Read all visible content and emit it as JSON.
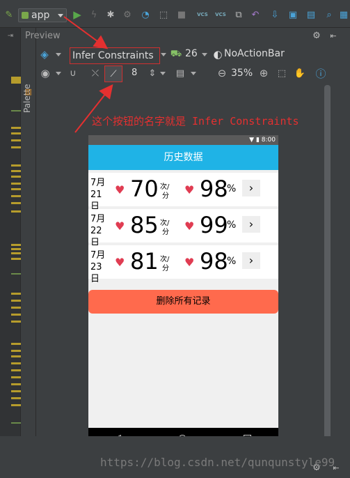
{
  "toolbar": {
    "app_config": "app",
    "vcs_1": "VCS",
    "vcs_2": "VCS"
  },
  "sidebar": {
    "palette_label": "Palette",
    "preview_label": "Preview"
  },
  "design_toolbar": {
    "infer_constraints_label": "Infer Constraints",
    "api_level": "26",
    "theme": "NoActionBar",
    "margin_value": "8",
    "zoom": "35%"
  },
  "annotation": {
    "text": "这个按钮的名字就是 Infer Constraints",
    "watermark": "https://blog.csdn.net/qunqunstyle99"
  },
  "phone": {
    "status_time": "8:00",
    "title": "历史数据",
    "records": [
      {
        "month": "7月",
        "day": "21日",
        "heart_rate": "70",
        "unit_top": "次/",
        "unit_bottom": "分",
        "oxygen": "98",
        "pct": "%",
        "chevron": "›"
      },
      {
        "month": "7月",
        "day": "22日",
        "heart_rate": "85",
        "unit_top": "次/",
        "unit_bottom": "分",
        "oxygen": "99",
        "pct": "%",
        "chevron": "›"
      },
      {
        "month": "7月",
        "day": "23日",
        "heart_rate": "81",
        "unit_top": "次/",
        "unit_bottom": "分",
        "oxygen": "98",
        "pct": "%",
        "chevron": "›"
      }
    ],
    "delete_all": "删除所有记录",
    "nav": {
      "back": "◁",
      "home": "○",
      "recent": "□"
    }
  },
  "colors": {
    "ide_bg": "#3c3f41",
    "app_bar": "#1fb3e6",
    "delete_button": "#ff6a4d",
    "annotation_red": "#e53030",
    "heart_red": "#e03c52"
  },
  "icons": [
    "hammer-icon",
    "run-icon",
    "debug-icon",
    "profiler-icon",
    "stop-icon",
    "sync-icon",
    "undo-icon",
    "sdk-manager-icon",
    "layers-icon",
    "android-icon",
    "eye-icon",
    "magnet-icon",
    "magic-wand-icon",
    "hand-icon",
    "info-icon",
    "zoom-in-icon",
    "zoom-out-icon",
    "settings-icon",
    "heart-icon",
    "chevron-right-icon"
  ]
}
